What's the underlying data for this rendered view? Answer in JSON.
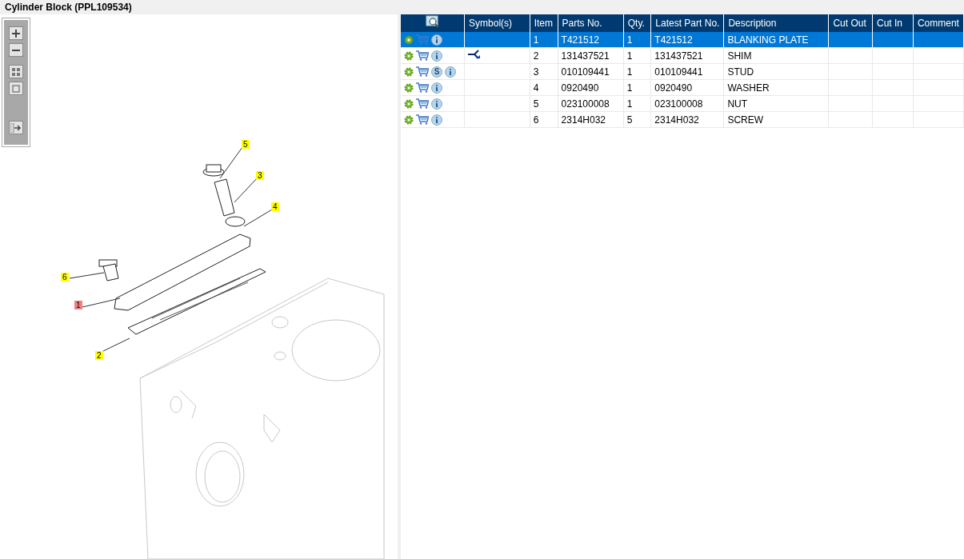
{
  "window": {
    "title": "Cylinder Block (PPL109534)"
  },
  "callouts": [
    {
      "label": "5",
      "selected": false
    },
    {
      "label": "3",
      "selected": false
    },
    {
      "label": "4",
      "selected": false
    },
    {
      "label": "6",
      "selected": false
    },
    {
      "label": "1",
      "selected": true
    },
    {
      "label": "2",
      "selected": false
    }
  ],
  "table": {
    "columns": [
      "Symbol(s)",
      "Item",
      "Parts No.",
      "Qty.",
      "Latest Part No.",
      "Description",
      "Cut Out",
      "Cut In",
      "Comment"
    ],
    "rows": [
      {
        "selected": true,
        "badge": null,
        "symbol": false,
        "item": "1",
        "parts_no": "T421512",
        "qty": "1",
        "latest_part_no": "T421512",
        "description": "BLANKING PLATE"
      },
      {
        "selected": false,
        "badge": null,
        "symbol": true,
        "item": "2",
        "parts_no": "131437521",
        "qty": "1",
        "latest_part_no": "131437521",
        "description": "SHIM"
      },
      {
        "selected": false,
        "badge": "S",
        "symbol": false,
        "item": "3",
        "parts_no": "010109441",
        "qty": "1",
        "latest_part_no": "010109441",
        "description": "STUD"
      },
      {
        "selected": false,
        "badge": null,
        "symbol": false,
        "item": "4",
        "parts_no": "0920490",
        "qty": "1",
        "latest_part_no": "0920490",
        "description": "WASHER"
      },
      {
        "selected": false,
        "badge": null,
        "symbol": false,
        "item": "5",
        "parts_no": "023100008",
        "qty": "1",
        "latest_part_no": "023100008",
        "description": "NUT"
      },
      {
        "selected": false,
        "badge": null,
        "symbol": false,
        "item": "6",
        "parts_no": "2314H032",
        "qty": "5",
        "latest_part_no": "2314H032",
        "description": "SCREW"
      }
    ]
  }
}
